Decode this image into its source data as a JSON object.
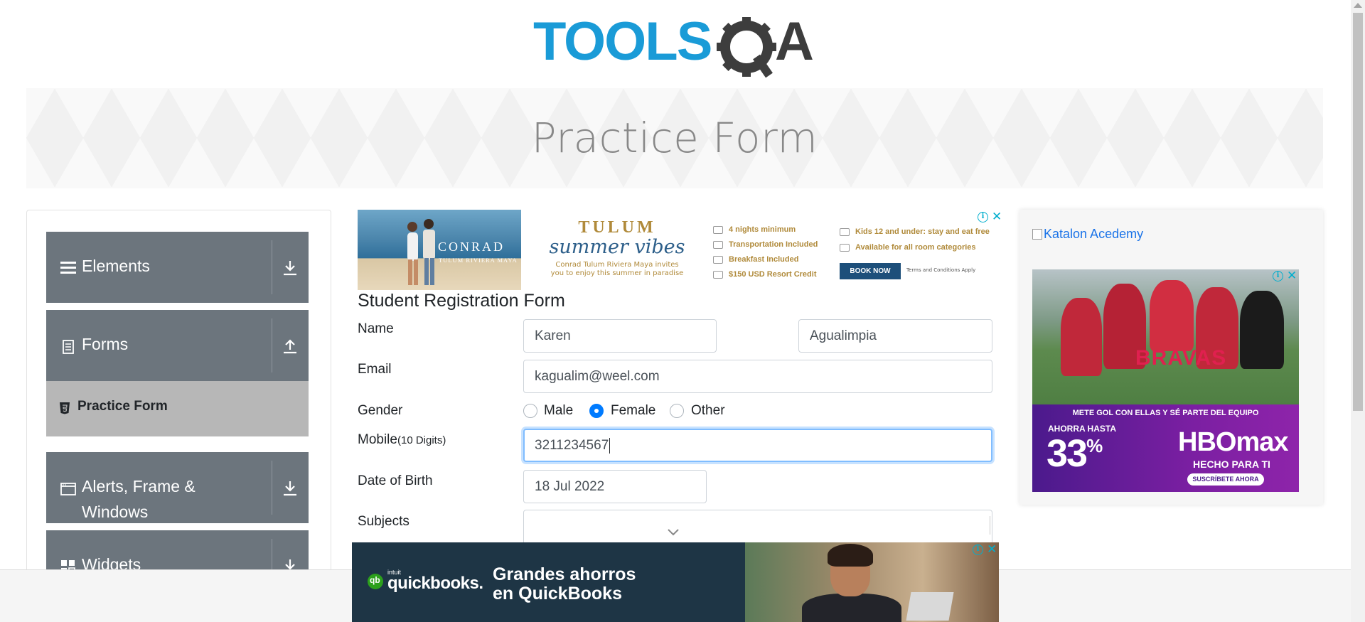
{
  "logo": {
    "text_left": "TOOLS",
    "text_right": "A"
  },
  "banner": {
    "title": "Practice Form"
  },
  "sidebar": {
    "groups": [
      {
        "label": "Elements",
        "icon": "hamburger-icon"
      },
      {
        "label": "Forms",
        "icon": "document-icon"
      },
      {
        "label": "Alerts, Frame &",
        "label2": "Windows",
        "icon": "window-icon"
      },
      {
        "label": "Widgets",
        "icon": "widgets-icon"
      }
    ],
    "active_item": {
      "label": "Practice Form",
      "icon": "html5-icon"
    }
  },
  "ad_top": {
    "brand": "CONRAD",
    "brand_sub": "TULUM RIVIERA MAYA",
    "headline": "TULUM",
    "script": "summer vibes",
    "tagline_1": "Conrad Tulum Riviera Maya invites",
    "tagline_2": "you to enjoy this summer in paradise",
    "features": [
      "4 nights minimum",
      "Transportation Included",
      "Breakfast Included",
      "$150 USD Resort Credit",
      "Kids 12 and under: stay and eat free",
      "Available for all room categories"
    ],
    "cta": "BOOK NOW",
    "terms": "Terms and Conditions Apply"
  },
  "form": {
    "title": "Student Registration Form",
    "name_label": "Name",
    "first_name": "Karen",
    "last_name": "Agualimpia",
    "email_label": "Email",
    "email": "kagualim@weel.com",
    "gender_label": "Gender",
    "gender_options": [
      "Male",
      "Female",
      "Other"
    ],
    "gender_selected": "Female",
    "mobile_label": "Mobile",
    "mobile_hint": "(10 Digits)",
    "mobile": "3211234567",
    "dob_label": "Date of Birth",
    "dob": "18 Jul 2022",
    "subjects_label": "Subjects"
  },
  "ad_right": {
    "link_text": "Katalon Acedemy",
    "show_title": "BRAVAS",
    "meta": "METE GOL CON ELLAS Y SÉ PARTE DEL EQUIPO",
    "save_label": "AHORRA HASTA",
    "percent": "33",
    "percent_sign": "%",
    "brand": "HBOmax",
    "tagline": "HECHO PARA TI",
    "cta": "SUSCRÍBETE AHORA"
  },
  "ad_bottom": {
    "intuit": "intuit",
    "brand": "quickbooks.",
    "headline_1": "Grandes ahorros",
    "headline_2": "en QuickBooks"
  },
  "colors": {
    "logo_blue": "#1a9bd7",
    "logo_dark": "#3d3d3d",
    "sidebar_group": "#6c757d",
    "sidebar_active": "#b7b7b7",
    "radio_selected": "#007bff",
    "focus_border": "#80bdff",
    "link": "#1a73e8",
    "adchoice": "#00aecd"
  }
}
